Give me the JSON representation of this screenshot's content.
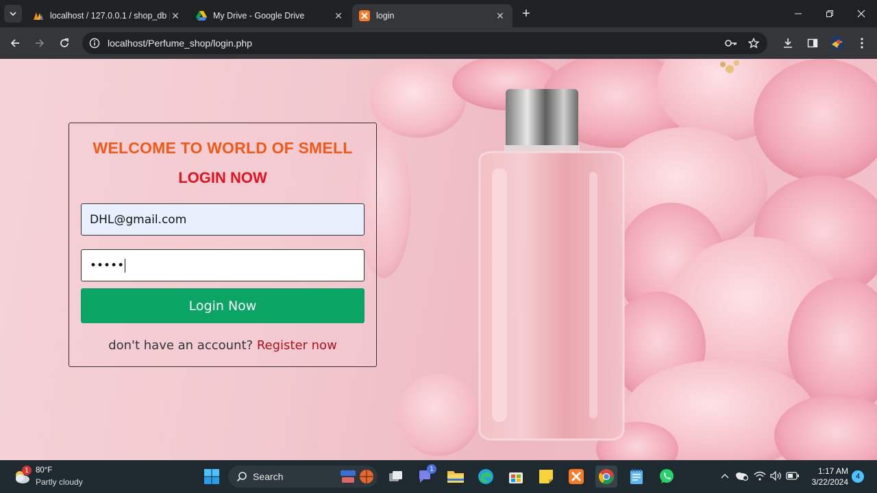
{
  "browser": {
    "tabs": [
      {
        "title": "localhost / 127.0.0.1 / shop_db |",
        "active": false
      },
      {
        "title": "My Drive - Google Drive",
        "active": false
      },
      {
        "title": "login",
        "active": true
      }
    ],
    "url": "localhost/Perfume_shop/login.php"
  },
  "page": {
    "welcome_heading": "WELCOME TO WORLD OF SMELL",
    "login_heading": "LOGIN NOW",
    "email_value": "DHL@gmail.com",
    "password_mask": "•••••",
    "login_button": "Login Now",
    "register_prompt": "don't have an account?",
    "register_link": "Register now"
  },
  "taskbar": {
    "weather_temp": "80°F",
    "weather_condition": "Partly cloudy",
    "weather_badge": "1",
    "search_label": "Search",
    "teams_badge": "1",
    "time": "1:17 AM",
    "date": "3/22/2024",
    "notification_count": "4"
  },
  "colors": {
    "welcome": "#f05a16",
    "login_heading": "#e4121c",
    "login_button": "#0aa564",
    "register_link": "#b2101c"
  }
}
